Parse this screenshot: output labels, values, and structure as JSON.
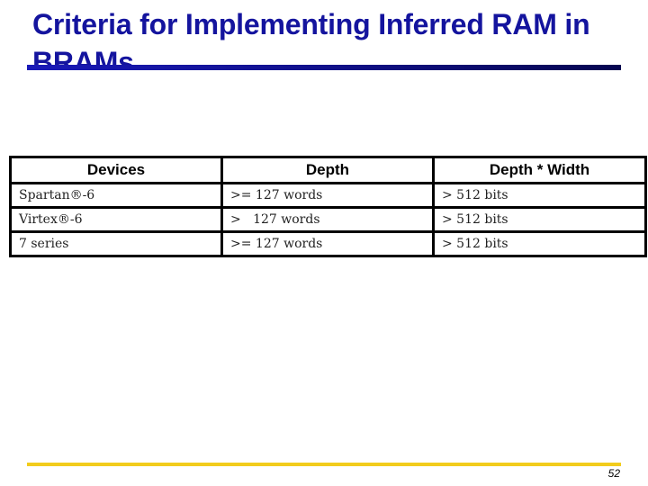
{
  "slide": {
    "title": "Criteria for Implementing Inferred RAM in BRAMs",
    "page_number": "52",
    "colors": {
      "title": "#14149e",
      "title_bar": "#10108a",
      "footer_bar": "#f2cc1c"
    }
  },
  "table": {
    "headers": [
      "Devices",
      "Depth",
      "Depth * Width"
    ],
    "rows": [
      [
        "Spartan®-6",
        ">= 127 words",
        "> 512 bits"
      ],
      [
        "Virtex®-6",
        ">   127 words",
        "> 512 bits"
      ],
      [
        "7 series",
        ">= 127 words",
        "> 512 bits"
      ]
    ]
  }
}
